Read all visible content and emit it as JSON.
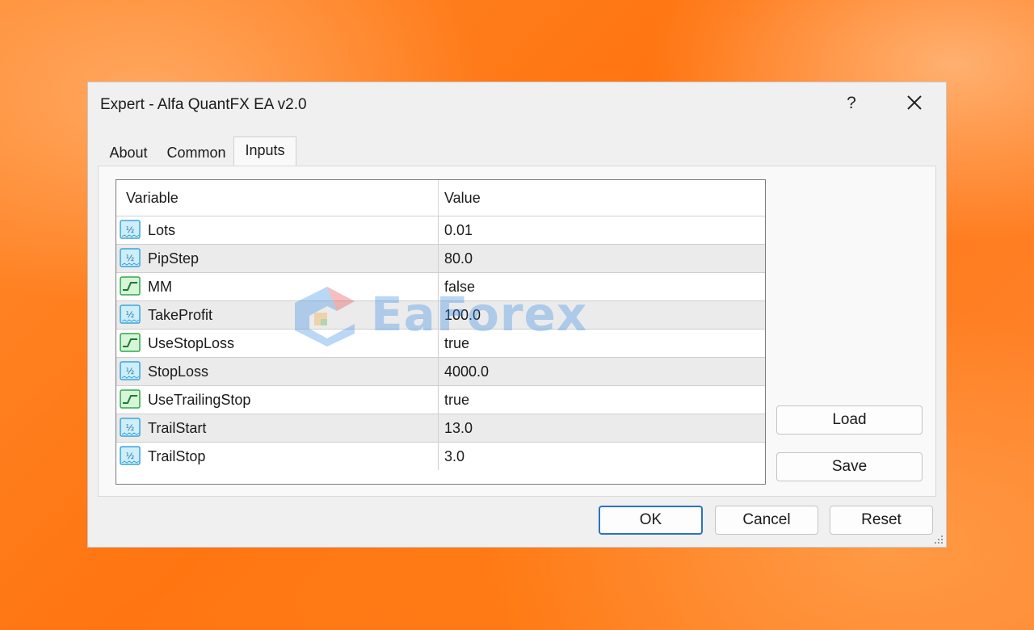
{
  "window": {
    "title": "Expert - Alfa QuantFX EA v2.0",
    "help_label": "?",
    "close_icon": "close-icon"
  },
  "tabs": [
    {
      "label": "About",
      "active": false
    },
    {
      "label": "Common",
      "active": false
    },
    {
      "label": "Inputs",
      "active": true
    }
  ],
  "grid": {
    "headers": {
      "variable": "Variable",
      "value": "Value"
    },
    "rows": [
      {
        "name": "Lots",
        "value": "0.01",
        "icon": "double-value-icon"
      },
      {
        "name": "PipStep",
        "value": "80.0",
        "icon": "double-value-icon"
      },
      {
        "name": "MM",
        "value": "false",
        "icon": "boolean-value-icon"
      },
      {
        "name": "TakeProfit",
        "value": "100.0",
        "icon": "double-value-icon"
      },
      {
        "name": "UseStopLoss",
        "value": "true",
        "icon": "boolean-value-icon"
      },
      {
        "name": "StopLoss",
        "value": "4000.0",
        "icon": "double-value-icon"
      },
      {
        "name": "UseTrailingStop",
        "value": "true",
        "icon": "boolean-value-icon"
      },
      {
        "name": "TrailStart",
        "value": "13.0",
        "icon": "double-value-icon"
      },
      {
        "name": "TrailStop",
        "value": "3.0",
        "icon": "double-value-icon"
      }
    ]
  },
  "side_buttons": {
    "load": "Load",
    "save": "Save"
  },
  "footer_buttons": {
    "ok": "OK",
    "cancel": "Cancel",
    "reset": "Reset"
  },
  "watermark": {
    "text": "EaForex"
  },
  "colors": {
    "accent": "#2b73c6",
    "double_icon": "#3aa6d8",
    "boolean_icon": "#2fa84f",
    "background": "#ff7a1a"
  }
}
